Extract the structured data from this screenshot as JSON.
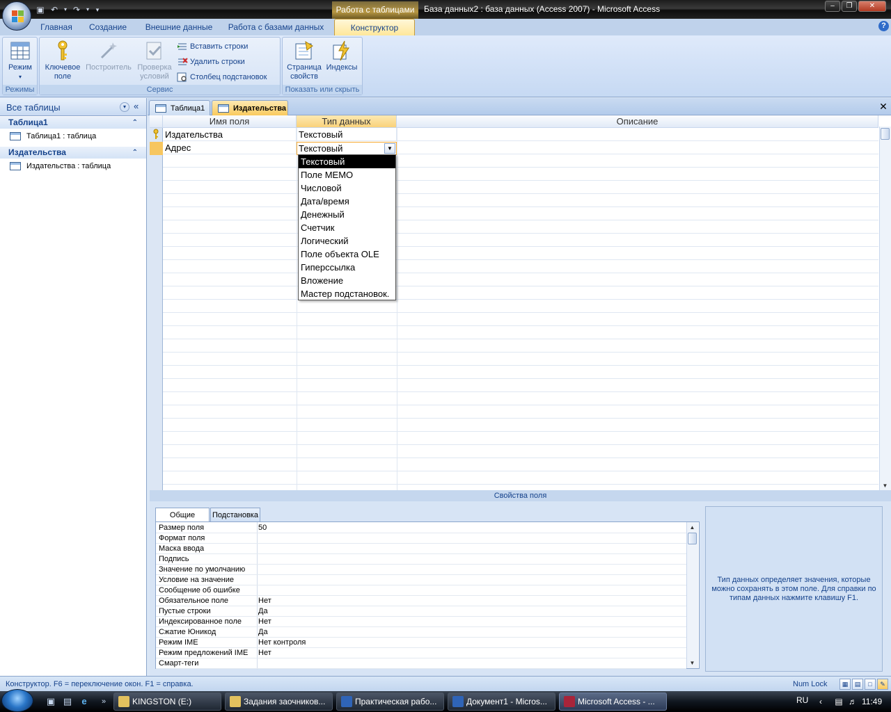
{
  "window": {
    "title": "База данных2 : база данных (Access 2007) - Microsoft Access",
    "contextual_tab_title": "Работа с таблицами"
  },
  "ribbon_tabs": [
    "Главная",
    "Создание",
    "Внешние данные",
    "Работа с базами данных",
    "Конструктор"
  ],
  "ribbon": {
    "groups": {
      "modes": "Режимы",
      "service": "Сервис",
      "show_hide": "Показать или скрыть"
    },
    "view_btn": "Режим",
    "key_btn_1": "Ключевое",
    "key_btn_2": "поле",
    "builder_btn": "Построитель",
    "validate_btn_1": "Проверка",
    "validate_btn_2": "условий",
    "insert_rows": "Вставить строки",
    "delete_rows": "Удалить строки",
    "lookup_column": "Столбец  подстановок",
    "property_sheet_1": "Страница",
    "property_sheet_2": "свойств",
    "indexes": "Индексы"
  },
  "nav_pane": {
    "title": "Все таблицы",
    "groups": [
      {
        "name": "Таблица1",
        "items": [
          "Таблица1 : таблица"
        ]
      },
      {
        "name": "Издательства",
        "items": [
          "Издательства : таблица"
        ]
      }
    ]
  },
  "doc_tabs": [
    "Таблица1",
    "Издательства"
  ],
  "design_grid": {
    "headers": {
      "field_name": "Имя поля",
      "data_type": "Тип данных",
      "description": "Описание"
    },
    "rows": [
      {
        "field_name": "Издательства",
        "data_type": "Текстовый",
        "primary_key": true
      },
      {
        "field_name": "Адрес",
        "data_type": "Текстовый",
        "primary_key": false
      }
    ]
  },
  "type_dropdown": {
    "selected": "Текстовый",
    "options": [
      "Текстовый",
      "Поле MEMO",
      "Числовой",
      "Дата/время",
      "Денежный",
      "Счетчик",
      "Логический",
      "Поле объекта OLE",
      "Гиперссылка",
      "Вложение",
      "Мастер подстановок."
    ]
  },
  "field_properties": {
    "title": "Свойства поля",
    "tabs": [
      "Общие",
      "Подстановка"
    ],
    "rows": [
      {
        "name": "Размер поля",
        "value": "50"
      },
      {
        "name": "Формат поля",
        "value": ""
      },
      {
        "name": "Маска ввода",
        "value": ""
      },
      {
        "name": "Подпись",
        "value": ""
      },
      {
        "name": "Значение по умолчанию",
        "value": ""
      },
      {
        "name": "Условие на значение",
        "value": ""
      },
      {
        "name": "Сообщение об ошибке",
        "value": ""
      },
      {
        "name": "Обязательное поле",
        "value": "Нет"
      },
      {
        "name": "Пустые строки",
        "value": "Да"
      },
      {
        "name": "Индексированное поле",
        "value": "Нет"
      },
      {
        "name": "Сжатие Юникод",
        "value": "Да"
      },
      {
        "name": "Режим IME",
        "value": "Нет контроля"
      },
      {
        "name": "Режим предложений IME",
        "value": "Нет"
      },
      {
        "name": "Смарт-теги",
        "value": ""
      }
    ],
    "help_text": "Тип данных определяет значения, которые можно сохранять в этом поле.  Для справки по типам данных нажмите клавишу F1."
  },
  "status_bar": {
    "text": "Конструктор.  F6 = переключение окон.  F1 = справка.",
    "num_lock": "Num Lock"
  },
  "taskbar": {
    "buttons": [
      "KINGSTON (E:)",
      "Задания заочников...",
      "Практическая рабо...",
      "Документ1 - Micros...",
      "Microsoft Access - ..."
    ],
    "lang": "RU",
    "clock": "11:49"
  }
}
